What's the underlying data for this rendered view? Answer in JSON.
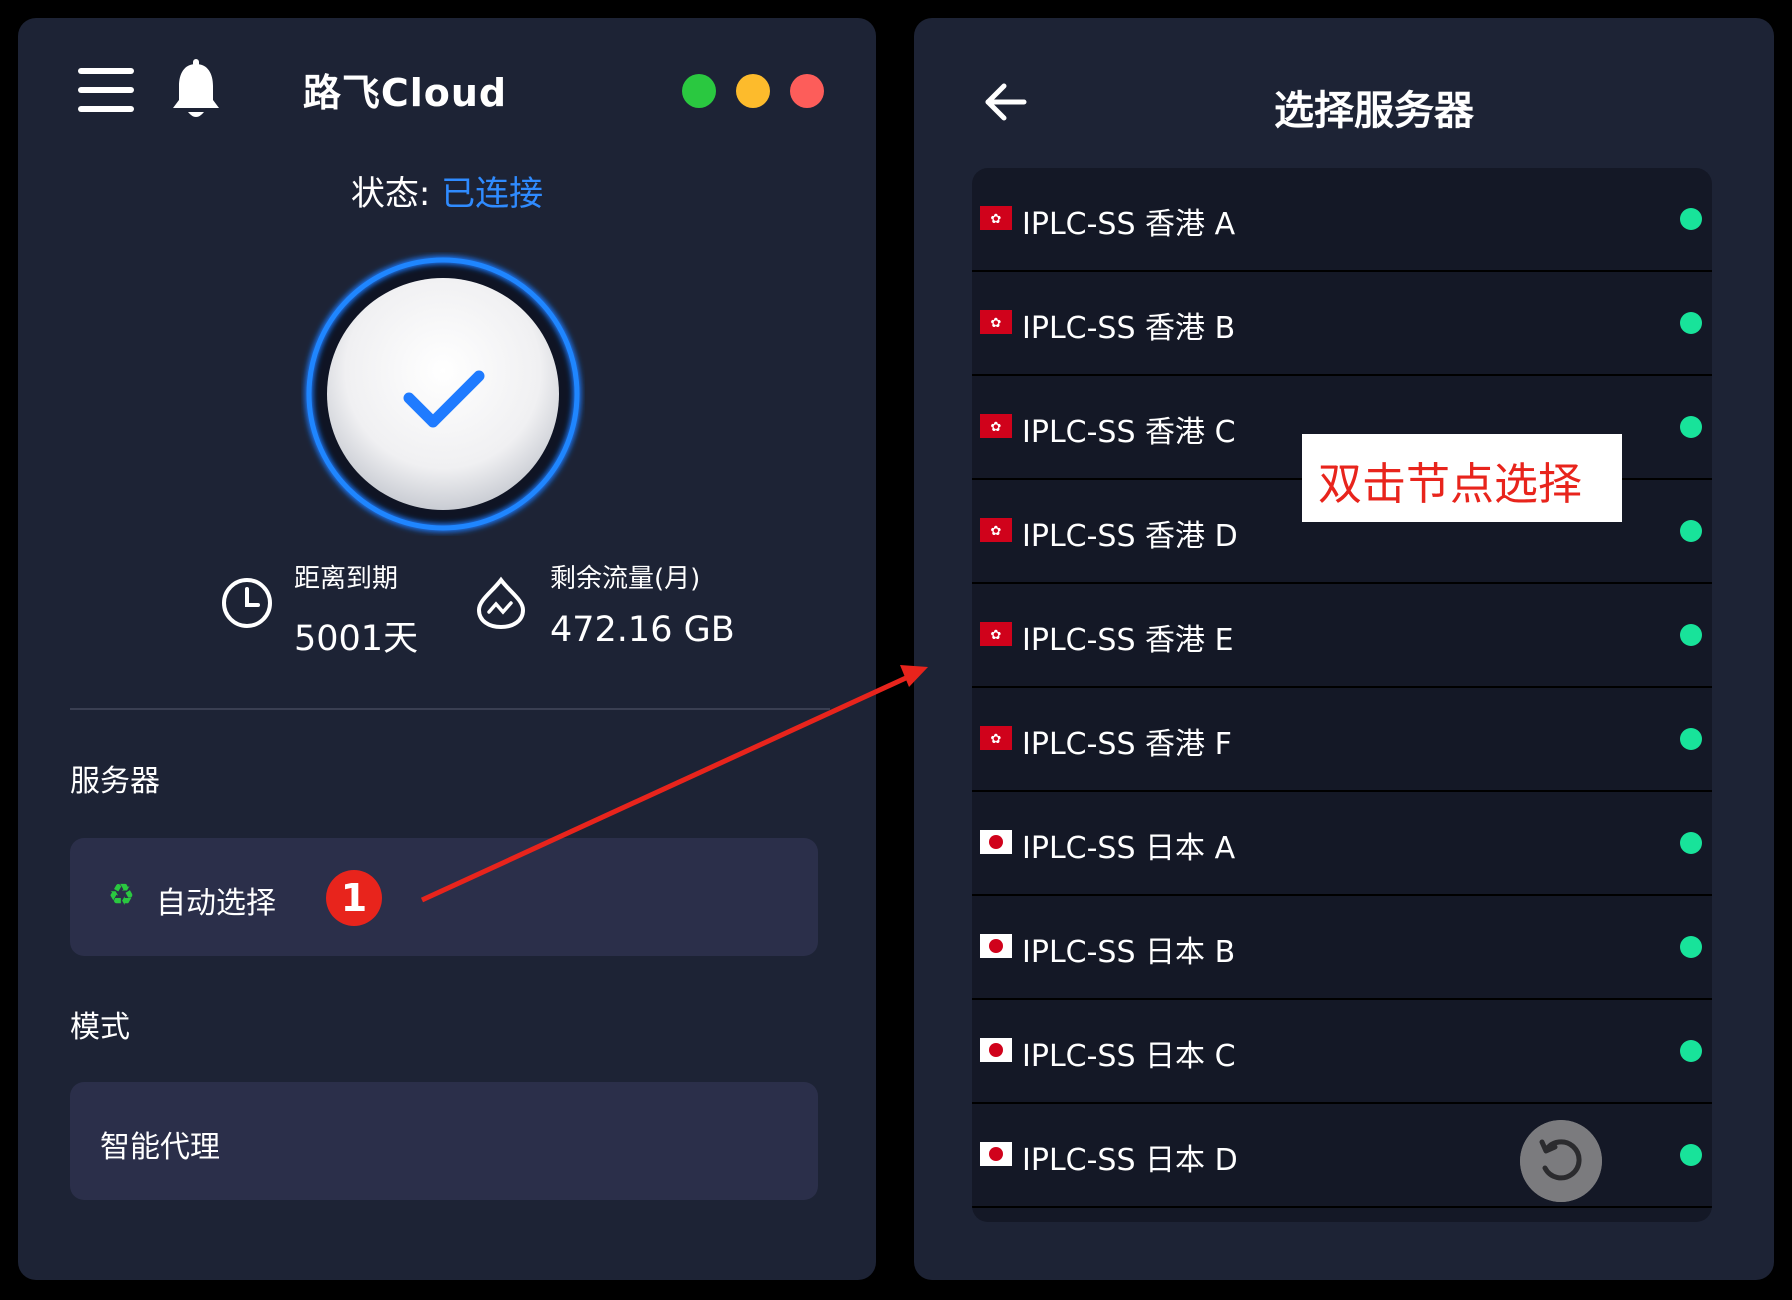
{
  "app": {
    "title": "路飞Cloud"
  },
  "status": {
    "label": "状态:",
    "value": "已连接"
  },
  "stats": {
    "expiry": {
      "label": "距离到期",
      "value": "5001天"
    },
    "traffic": {
      "label": "剩余流量(月)",
      "value": "472.16 GB"
    }
  },
  "server_section": {
    "label": "服务器",
    "selected": "自动选择"
  },
  "mode_section": {
    "label": "模式",
    "selected": "智能代理"
  },
  "annotation": {
    "step": "1",
    "tip": "双击节点选择"
  },
  "right": {
    "title": "选择服务器",
    "servers": [
      {
        "name": "IPLC-SS 香港 A",
        "flag": "hk-flag-icon"
      },
      {
        "name": "IPLC-SS 香港 B",
        "flag": "hk-flag-icon"
      },
      {
        "name": "IPLC-SS 香港 C",
        "flag": "hk-flag-icon"
      },
      {
        "name": "IPLC-SS 香港 D",
        "flag": "hk-flag-icon"
      },
      {
        "name": "IPLC-SS 香港 E",
        "flag": "hk-flag-icon"
      },
      {
        "name": "IPLC-SS 香港 F",
        "flag": "hk-flag-icon"
      },
      {
        "name": "IPLC-SS 日本 A",
        "flag": "jp-flag-icon"
      },
      {
        "name": "IPLC-SS 日本 B",
        "flag": "jp-flag-icon"
      },
      {
        "name": "IPLC-SS 日本 C",
        "flag": "jp-flag-icon"
      },
      {
        "name": "IPLC-SS 日本 D",
        "flag": "jp-flag-icon"
      }
    ]
  },
  "colors": {
    "panel": "#1d2335",
    "accent_blue": "#2f8bff",
    "online_green": "#18e39a",
    "annotation_red": "#e8241c",
    "window_green": "#2ac840",
    "window_yellow": "#fdbb2c",
    "window_red": "#fd5d5a"
  }
}
